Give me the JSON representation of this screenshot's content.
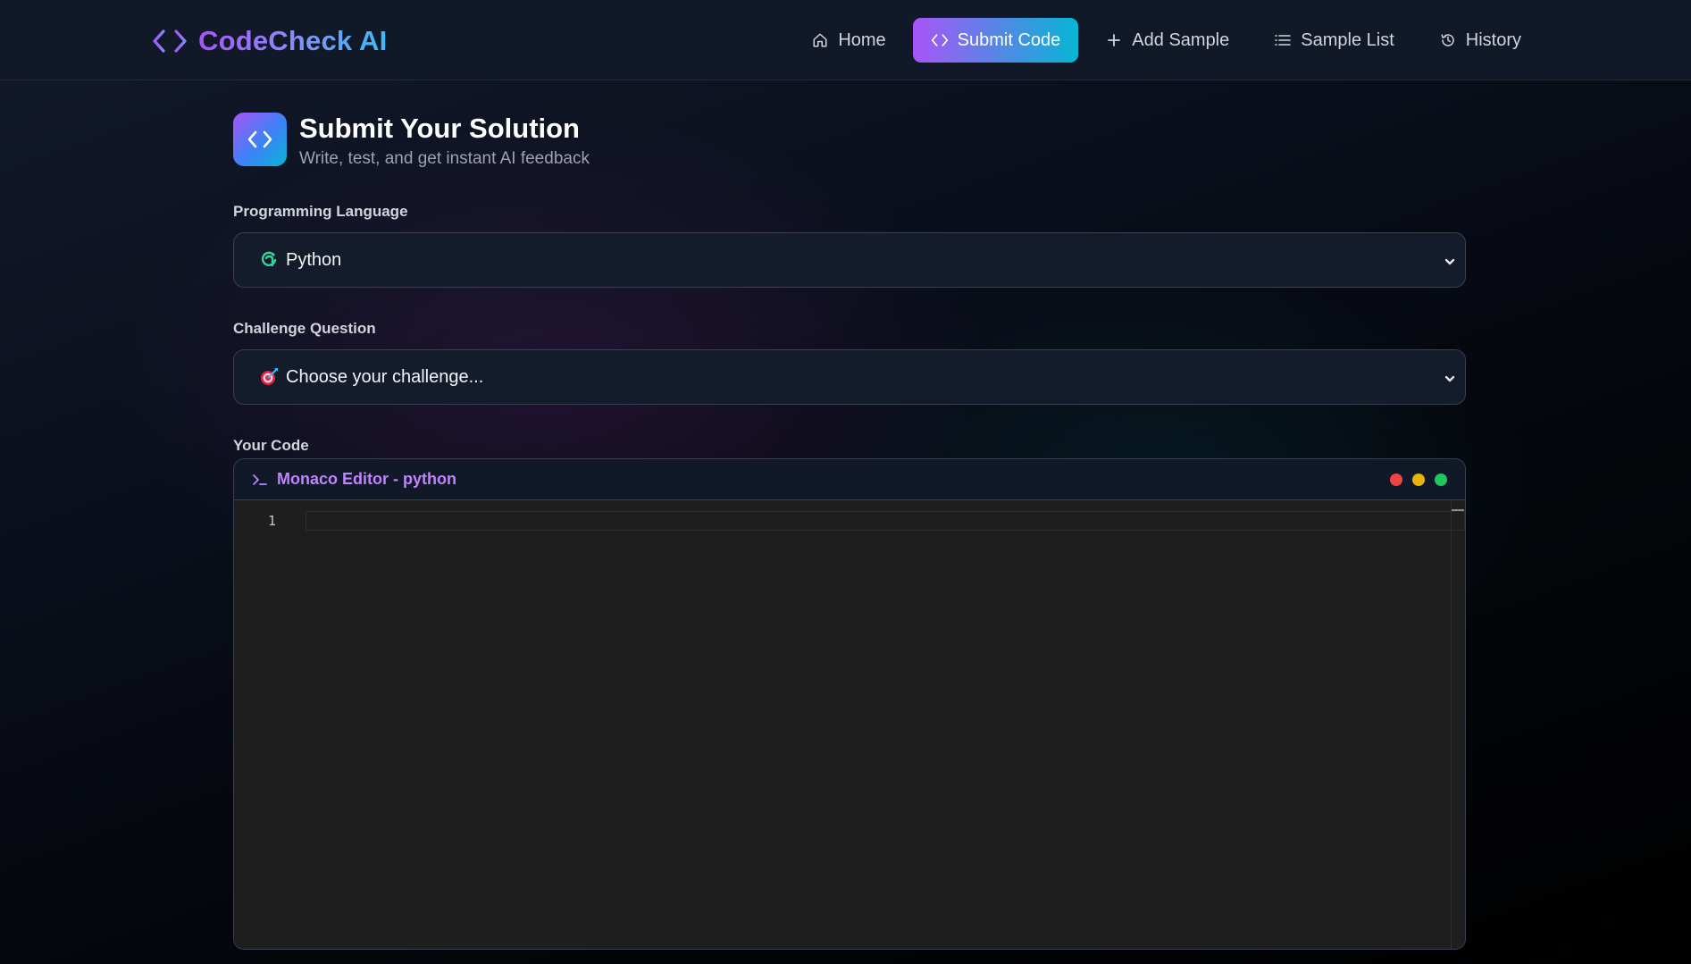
{
  "brand": {
    "name": "CodeCheck AI",
    "icon": "code-brackets-icon"
  },
  "nav": [
    {
      "label": "Home",
      "icon": "home-icon",
      "active": false
    },
    {
      "label": "Submit Code",
      "icon": "code-brackets-icon",
      "active": true
    },
    {
      "label": "Add Sample",
      "icon": "plus-icon",
      "active": false
    },
    {
      "label": "Sample List",
      "icon": "list-icon",
      "active": false
    },
    {
      "label": "History",
      "icon": "history-icon",
      "active": false
    }
  ],
  "header": {
    "title": "Submit Your Solution",
    "subtitle": "Write, test, and get instant AI feedback"
  },
  "form": {
    "language_label": "Programming Language",
    "language_value": "Python",
    "challenge_label": "Challenge Question",
    "challenge_value": "Choose your challenge...",
    "code_label": "Your Code"
  },
  "editor": {
    "title": "Monaco Editor - python",
    "line_numbers": [
      "1"
    ],
    "window_dots": [
      "#ef4444",
      "#eab308",
      "#22c55e"
    ]
  },
  "colors": {
    "accent_purple": "#a855f7",
    "accent_cyan": "#06b6d4",
    "nav_bg": "#111827",
    "editor_bg": "#1e1e1e"
  }
}
